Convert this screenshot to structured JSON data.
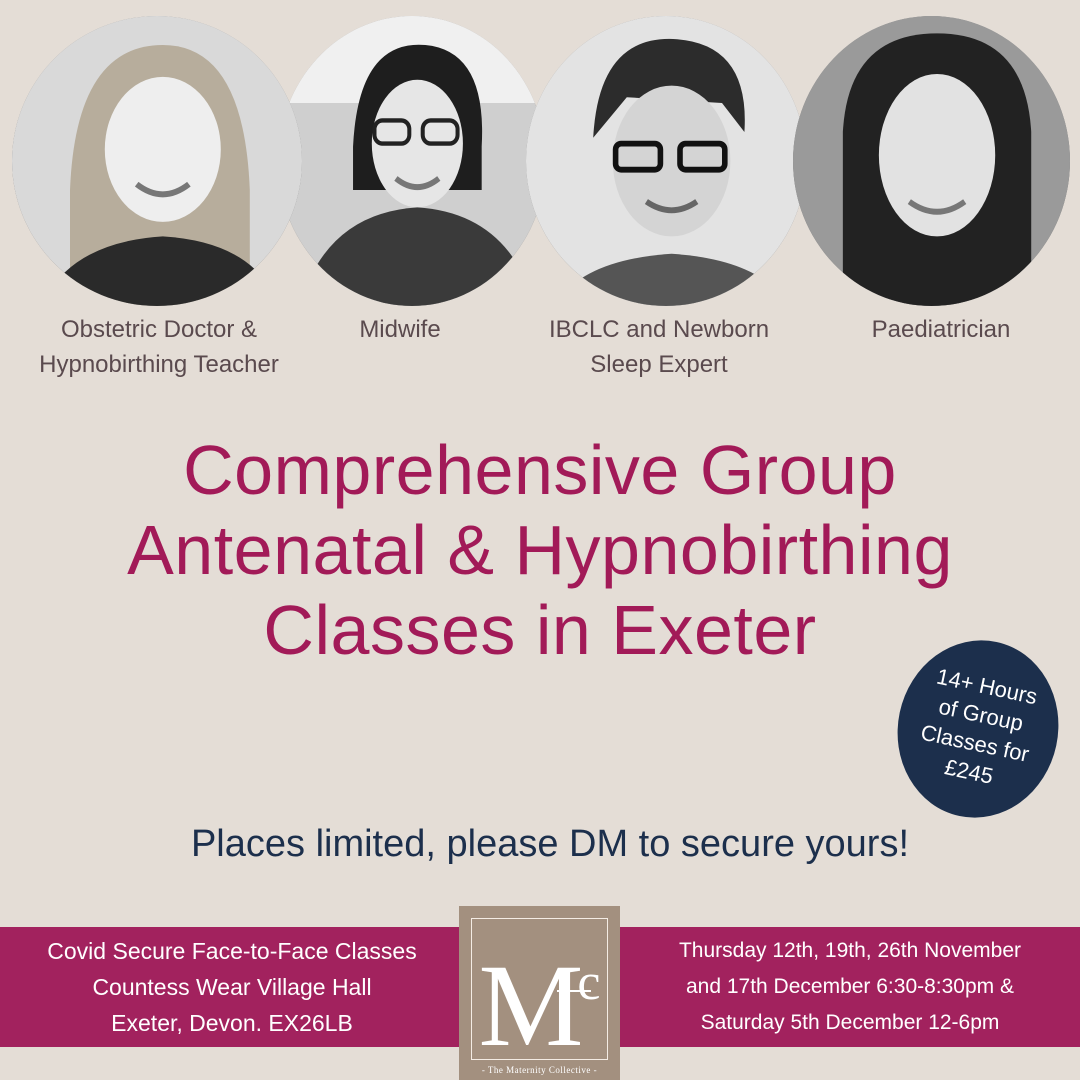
{
  "team": [
    {
      "caption_lines": [
        "Obstetric Doctor &",
        "Hypnobirthing Teacher"
      ]
    },
    {
      "caption_lines": [
        "Midwife"
      ]
    },
    {
      "caption_lines": [
        "IBCLC and Newborn",
        "Sleep Expert"
      ]
    },
    {
      "caption_lines": [
        "Paediatrician"
      ]
    }
  ],
  "headline_lines": [
    "Comprehensive Group",
    "Antenatal & Hypnobirthing",
    "Classes in Exeter"
  ],
  "badge_lines": [
    "14+ Hours",
    "of Group",
    "Classes for",
    "£245"
  ],
  "cta": "Places limited, please DM to secure yours!",
  "footer": {
    "left_lines": [
      "Covid Secure Face-to-Face Classes",
      "Countess Wear Village Hall",
      "Exeter, Devon. EX26LB"
    ],
    "right_lines": [
      "Thursday 12th, 19th, 26th November",
      "and 17th December 6:30-8:30pm &",
      "Saturday 5th December 12-6pm"
    ]
  },
  "logo": {
    "monogram_main": "M",
    "monogram_sup": "c",
    "tagline": "- The Maternity Collective -"
  },
  "colors": {
    "background": "#e4ddd6",
    "headline": "#a21a58",
    "navy": "#1c2f4c",
    "footer_band": "#a2225e",
    "logo_bg": "#a3907f"
  }
}
